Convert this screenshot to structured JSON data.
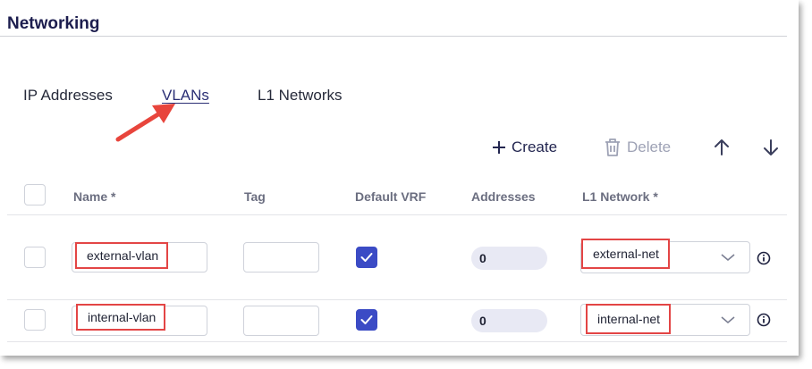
{
  "section": {
    "title": "Networking"
  },
  "tabs": [
    {
      "label": "IP Addresses",
      "active": false
    },
    {
      "label": "VLANs",
      "active": true
    },
    {
      "label": "L1 Networks",
      "active": false
    }
  ],
  "toolbar": {
    "create_label": "Create",
    "delete_label": "Delete",
    "icons": [
      "plus-icon",
      "trash-icon",
      "arrow-up-icon",
      "arrow-down-icon"
    ]
  },
  "table": {
    "columns": [
      "Name *",
      "Tag",
      "Default VRF",
      "Addresses",
      "L1 Network *"
    ],
    "rows": [
      {
        "name": "external-vlan",
        "tag": "",
        "default_vrf": true,
        "addresses": "0",
        "l1_network": "external-net"
      },
      {
        "name": "internal-vlan",
        "tag": "",
        "default_vrf": true,
        "addresses": "0",
        "l1_network": "internal-net"
      }
    ]
  },
  "colors": {
    "accent": "#3b4bc5",
    "title": "#1c1d4e",
    "highlight": "#e34545",
    "pill": "#e8e9f4",
    "disabled": "#9ea2b5"
  }
}
